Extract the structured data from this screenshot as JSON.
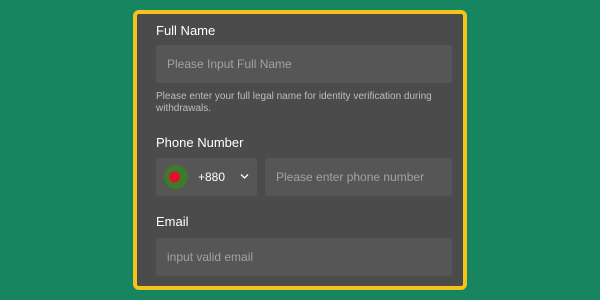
{
  "full_name": {
    "label": "Full Name",
    "placeholder": "Please Input Full Name",
    "hint": "Please enter your full legal name for identity verification during withdrawals."
  },
  "phone": {
    "label": "Phone Number",
    "country_code": "+880",
    "flag_icon": "bangladesh-flag-icon",
    "placeholder": "Please enter phone number"
  },
  "email": {
    "label": "Email",
    "placeholder": "input valid email"
  },
  "colors": {
    "background": "#178560",
    "panel": "#4c4b4b",
    "border": "#f6c419",
    "field": "#575656"
  }
}
